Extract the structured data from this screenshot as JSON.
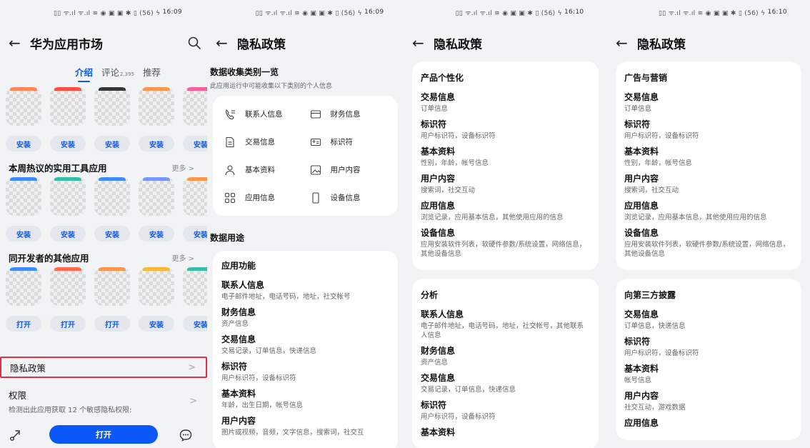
{
  "status_text": "▯▯ ᯤ.ıl ᯤ.ıl ≋ ◉ ▣ ▣ ✱ ▯ (56) ϟ",
  "times": [
    "16:09",
    "16:09",
    "16:10",
    "16:10"
  ],
  "panel1": {
    "title": "华为应用市场",
    "tabs": {
      "intro": "介绍",
      "reviews": "评论",
      "reviews_count": "2,395",
      "recommend": "推荐"
    },
    "row1_buttons": [
      "安装",
      "安装",
      "安装",
      "安装",
      "安装"
    ],
    "row1_colors": [
      "#ff7a45",
      "#ff3b30",
      "#222222",
      "#ff8c3a",
      "#ff4d8f"
    ],
    "section_weekly": {
      "title": "本周热议的实用工具应用",
      "more": "更多 >"
    },
    "row2_labels": [
      "",
      "",
      "",
      "",
      ""
    ],
    "row2_buttons": [
      "安装",
      "安装",
      "安装",
      "安装",
      "安装"
    ],
    "row2_colors": [
      "#2d7ff9",
      "#22b8a0",
      "#2d7ff9",
      "#6c8cff",
      "#ff8c3a"
    ],
    "section_dev": {
      "title": "同开发者的其他应用",
      "more": "更多 >"
    },
    "row3_buttons": [
      "打开",
      "打开",
      "打开",
      "安装",
      "安装"
    ],
    "row3_colors": [
      "#2d7ff9",
      "#ff5a3c",
      "#ff8c3a",
      "#ffb020",
      "#22b8a0"
    ],
    "privacy": {
      "title": "隐私政策",
      "chevron": ">"
    },
    "permissions": {
      "title": "权限",
      "subtitle": "检测出此应用获取 12 个敏感隐私权限:",
      "chevron": ">"
    },
    "open_button": "打开"
  },
  "panel2": {
    "title": "隐私政策",
    "collect_title": "数据收集类别一览",
    "collect_subtitle": "此应用运行中可能收集以下类别的个人信息",
    "categories": [
      {
        "label": "联系人信息",
        "icon": "contacts-icon"
      },
      {
        "label": "财务信息",
        "icon": "card-icon"
      },
      {
        "label": "交易信息",
        "icon": "document-icon"
      },
      {
        "label": "标识符",
        "icon": "id-card-icon"
      },
      {
        "label": "基本资料",
        "icon": "person-icon"
      },
      {
        "label": "用户内容",
        "icon": "image-icon"
      },
      {
        "label": "应用信息",
        "icon": "apps-grid-icon"
      },
      {
        "label": "设备信息",
        "icon": "phone-icon"
      }
    ],
    "usage_title": "数据用途",
    "card_title": "应用功能",
    "entries": [
      {
        "h": "联系人信息",
        "d": "电子邮件地址，电话号码，地址，社交帐号"
      },
      {
        "h": "财务信息",
        "d": "资产信息"
      },
      {
        "h": "交易信息",
        "d": "交易记录，订单信息，快递信息"
      },
      {
        "h": "标识符",
        "d": "用户标识符，设备标识符"
      },
      {
        "h": "基本资料",
        "d": "年龄，出生日期，帐号信息"
      },
      {
        "h": "用户内容",
        "d": "图片或视频，音频，文字信息，搜索词，社交互"
      }
    ]
  },
  "panel3": {
    "title": "隐私政策",
    "card1": {
      "title": "产品个性化",
      "entries": [
        {
          "h": "交易信息",
          "d": "订单信息"
        },
        {
          "h": "标识符",
          "d": "用户标识符，设备标识符"
        },
        {
          "h": "基本资料",
          "d": "性别，年龄，帐号信息"
        },
        {
          "h": "用户内容",
          "d": "搜索词，社交互动"
        },
        {
          "h": "应用信息",
          "d": "浏览记录，应用基本信息，其他使用应用的信息"
        },
        {
          "h": "设备信息",
          "d": "应用安装软件列表，软硬件参数/系统设置，网络信息，其他设备信息"
        }
      ]
    },
    "card2": {
      "title": "分析",
      "entries": [
        {
          "h": "联系人信息",
          "d": "电子邮件地址，电话号码，地址，社交帐号，其他联系人信息"
        },
        {
          "h": "财务信息",
          "d": "资产信息"
        },
        {
          "h": "交易信息",
          "d": "交易记录，订单信息，快递信息"
        },
        {
          "h": "标识符",
          "d": "用户标识符，设备标识符"
        },
        {
          "h": "基本资料",
          "d": ""
        }
      ]
    }
  },
  "panel4": {
    "title": "隐私政策",
    "card1": {
      "title": "广告与营销",
      "entries": [
        {
          "h": "交易信息",
          "d": "订单信息"
        },
        {
          "h": "标识符",
          "d": "用户标识符，设备标识符"
        },
        {
          "h": "基本资料",
          "d": "性别，年龄，帐号信息"
        },
        {
          "h": "用户内容",
          "d": "搜索词，社交互动"
        },
        {
          "h": "应用信息",
          "d": "浏览记录，应用基本信息，其他使用应用的信息"
        },
        {
          "h": "设备信息",
          "d": "应用安装软件列表，软硬件参数/系统设置，网络信息，其他设备信息"
        }
      ]
    },
    "card2": {
      "title": "向第三方披露",
      "entries": [
        {
          "h": "交易信息",
          "d": "订单信息，快递信息"
        },
        {
          "h": "标识符",
          "d": "用户标识符，设备标识符"
        },
        {
          "h": "基本资料",
          "d": "帐号信息"
        },
        {
          "h": "用户内容",
          "d": "社交互动，游戏数据"
        },
        {
          "h": "应用信息",
          "d": ""
        }
      ]
    }
  },
  "colors": {
    "accent": "#0a59f7",
    "highlight_border": "#e0304a",
    "background": "#f1f3f5"
  }
}
